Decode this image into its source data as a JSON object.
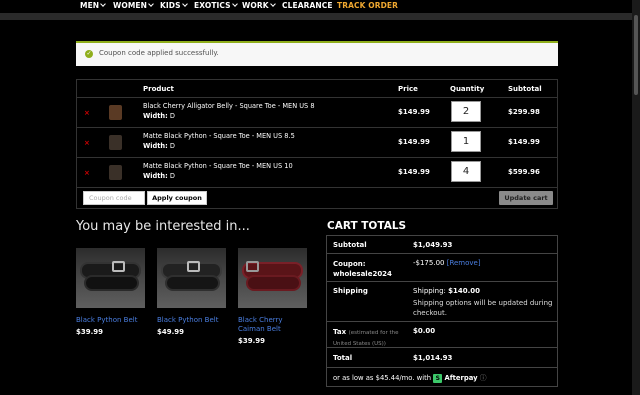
{
  "nav": {
    "items": [
      "MEN",
      "WOMEN",
      "KIDS",
      "EXOTICS",
      "WORK",
      "CLEARANCE",
      "TRACK ORDER"
    ],
    "accent_color": "#f0a830"
  },
  "notice": {
    "text": "Coupon code applied successfully.",
    "icon": "check-circle-icon",
    "color": "#8fae1b"
  },
  "cart": {
    "headers": {
      "product": "Product",
      "price": "Price",
      "quantity": "Quantity",
      "subtotal": "Subtotal"
    },
    "items": [
      {
        "name": "Black Cherry Alligator Belly - Square Toe - MEN US 8",
        "width_label": "Width:",
        "width_value": "D",
        "price": "$149.99",
        "quantity": "2",
        "subtotal": "$299.98"
      },
      {
        "name": "Matte Black Python - Square Toe - MEN US 8.5",
        "width_label": "Width:",
        "width_value": "D",
        "price": "$149.99",
        "quantity": "1",
        "subtotal": "$149.99"
      },
      {
        "name": "Matte Black Python - Square Toe - MEN US 10",
        "width_label": "Width:",
        "width_value": "D",
        "price": "$149.99",
        "quantity": "4",
        "subtotal": "$599.96"
      }
    ],
    "remove_symbol": "×",
    "coupon_placeholder": "Coupon code",
    "apply_label": "Apply coupon",
    "update_label": "Update cart"
  },
  "interested": {
    "title": "You may be interested in...",
    "products": [
      {
        "name": "Black Python Belt",
        "price": "$39.99"
      },
      {
        "name": "Black Python Belt",
        "price": "$49.99"
      },
      {
        "name": "Black Cherry Caiman Belt",
        "price": "$39.99"
      }
    ]
  },
  "totals": {
    "title": "CART TOTALS",
    "subtotal_label": "Subtotal",
    "subtotal_value": "$1,049.93",
    "coupon_label": "Coupon: wholesale2024",
    "coupon_value": "-$175.00",
    "coupon_remove": "[Remove]",
    "shipping_label": "Shipping",
    "shipping_prefix": "Shipping:",
    "shipping_value": "$140.00",
    "shipping_note": "Shipping options will be updated during checkout.",
    "tax_label": "Tax",
    "tax_note": "(estimated for the United States (US))",
    "tax_value": "$0.00",
    "total_label": "Total",
    "total_value": "$1,014.93",
    "afterpay_text": "or as low as $45.44/mo. with",
    "afterpay_brand": "Afterpay",
    "afterpay_info": "ⓘ"
  }
}
